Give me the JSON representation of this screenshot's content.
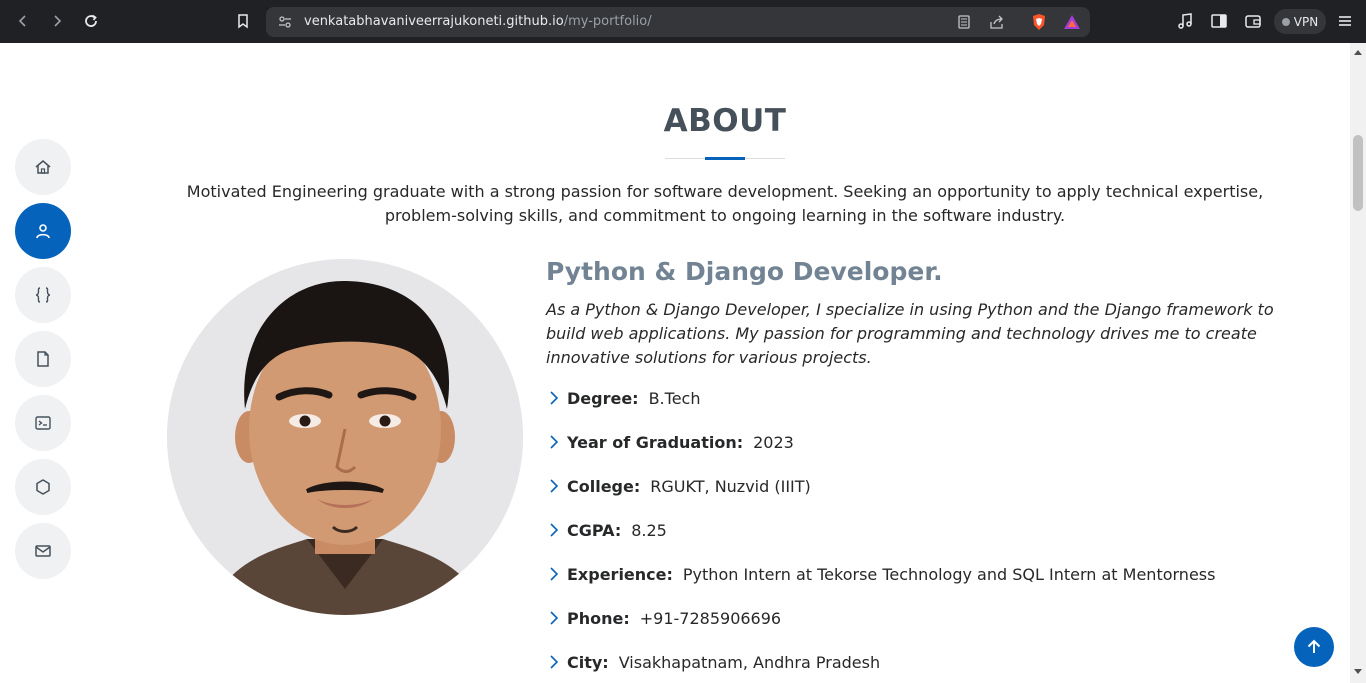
{
  "browser": {
    "url_host": "venkatabhavaniveerrajukoneti.github.io",
    "url_path": "/my-portfolio/",
    "vpn_label": "VPN",
    "icons": [
      "back-icon",
      "forward-icon",
      "reload-icon",
      "bookmark-icon",
      "tune-icon",
      "reader-icon",
      "share-icon",
      "brave-shield-icon",
      "brave-rewards-icon",
      "media-icon",
      "sidebar-icon",
      "wallet-icon",
      "menu-icon"
    ]
  },
  "side_nav": {
    "items": [
      {
        "name": "home",
        "icon": "home-icon",
        "active": false
      },
      {
        "name": "about",
        "icon": "person-icon",
        "active": true
      },
      {
        "name": "skills",
        "icon": "braces-icon",
        "active": false
      },
      {
        "name": "resume",
        "icon": "file-icon",
        "active": false
      },
      {
        "name": "projects",
        "icon": "terminal-icon",
        "active": false
      },
      {
        "name": "services",
        "icon": "circle-icon",
        "active": false
      },
      {
        "name": "contact",
        "icon": "envelope-icon",
        "active": false
      }
    ],
    "accent_color": "#0563bb"
  },
  "about": {
    "title": "ABOUT",
    "intro": "Motivated Engineering graduate with a strong passion for software development. Seeking an opportunity to apply technical expertise, problem-solving skills, and commitment to ongoing learning in the software industry.",
    "role_title": "Python & Django Developer.",
    "role_desc": "As a Python & Django Developer, I specialize in using Python and the Django framework to build web applications. My passion for programming and technology drives me to create innovative solutions for various projects.",
    "facts": [
      {
        "label": "Degree:",
        "value": "B.Tech"
      },
      {
        "label": "Year of Graduation:",
        "value": "2023"
      },
      {
        "label": "College:",
        "value": "RGUKT, Nuzvid (IIIT)"
      },
      {
        "label": "CGPA:",
        "value": "8.25"
      },
      {
        "label": "Experience:",
        "value": "Python Intern at Tekorse Technology and SQL Intern at Mentorness"
      },
      {
        "label": "Phone:",
        "value": "+91-7285906696"
      },
      {
        "label": "City:",
        "value": "Visakhapatnam, Andhra Pradesh"
      }
    ]
  }
}
